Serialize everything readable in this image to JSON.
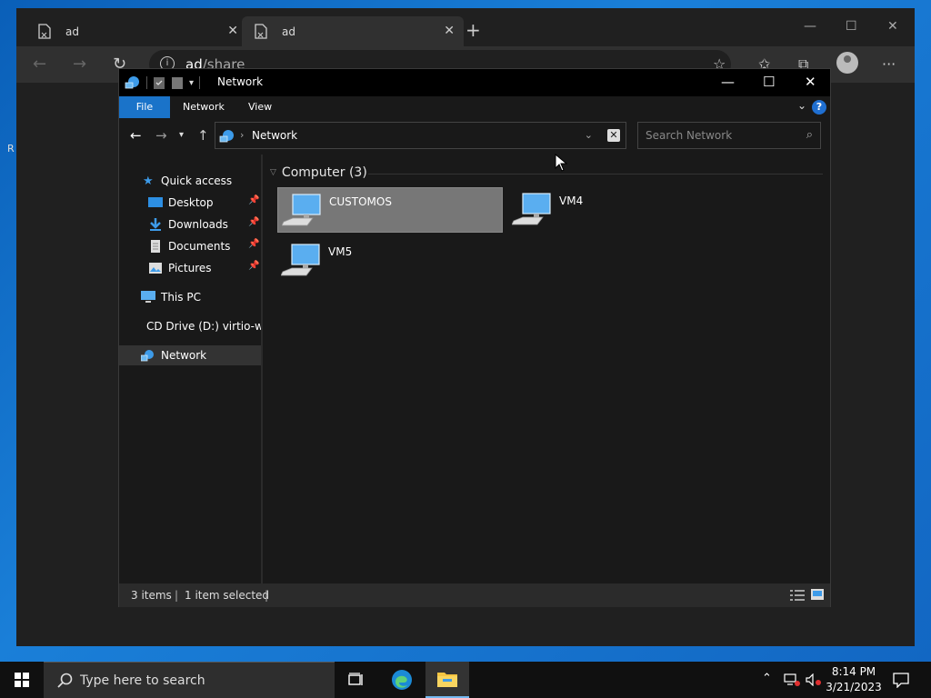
{
  "desktop": {
    "edge_label": "R"
  },
  "browser": {
    "tabs": [
      {
        "label": "ad"
      },
      {
        "label": "ad"
      }
    ],
    "address": {
      "host": "ad",
      "path": "/share"
    }
  },
  "explorer": {
    "title": "Network",
    "ribbon": {
      "file": "File",
      "network": "Network",
      "view": "View",
      "help": "?"
    },
    "path": "Network",
    "search_placeholder": "Search Network",
    "sidebar": {
      "quick_access": "Quick access",
      "desktop": "Desktop",
      "downloads": "Downloads",
      "documents": "Documents",
      "pictures": "Pictures",
      "this_pc": "This PC",
      "cd_drive": "CD Drive (D:) virtio-w",
      "network": "Network"
    },
    "group": {
      "label": "Computer (3)"
    },
    "computers": [
      {
        "name": "CUSTOMOS",
        "selected": true
      },
      {
        "name": "VM4",
        "selected": false
      },
      {
        "name": "VM5",
        "selected": false
      }
    ],
    "status": {
      "items": "3 items",
      "selected": "1 item selected"
    }
  },
  "taskbar": {
    "search_placeholder": "Type here to search",
    "time": "8:14 PM",
    "date": "3/21/2023"
  }
}
